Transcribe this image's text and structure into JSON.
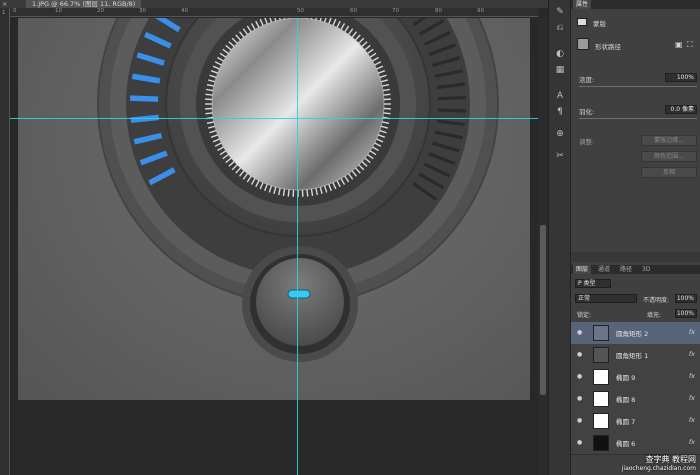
{
  "document": {
    "tab_label": "1.JPG @ 66.7% (图层 11, RGB/8)",
    "tab_close": "×"
  },
  "ruler": {
    "top_ticks": [
      "0",
      "10",
      "20",
      "30",
      "40",
      "50",
      "60",
      "70",
      "80",
      "90"
    ],
    "left_label": "1"
  },
  "tools": [
    "brush-icon",
    "history-icon",
    "adjust-icon",
    "swatch-icon",
    "type-icon",
    "paragraph-icon",
    "measure-icon",
    "tools-icon"
  ],
  "properties": {
    "header_tab": "属性",
    "mask_title": "蒙版",
    "mask_type": "形状路径",
    "density_label": "浓度:",
    "density_value": "100%",
    "feather_label": "羽化:",
    "feather_value": "0.0 像素",
    "refine_label": "调整:",
    "mask_edge_button": "蒙版边缘...",
    "color_range_button": "颜色范围...",
    "invert_button": "反相"
  },
  "layers_panel": {
    "tabs": [
      "图层",
      "通道",
      "路径",
      "3D"
    ],
    "kind_label": "P 类型",
    "blend_mode": "正常",
    "opacity_label": "不透明度:",
    "opacity_value": "100%",
    "lock_label": "锁定:",
    "fill_label": "填充:",
    "fill_value": "100%",
    "fx_label": "fx",
    "layers": [
      {
        "name": "圆角矩形 2",
        "selected": true
      },
      {
        "name": "圆角矩形 1",
        "selected": false
      },
      {
        "name": "椭圆 9",
        "selected": false
      },
      {
        "name": "椭圆 8",
        "selected": false
      },
      {
        "name": "椭圆 7",
        "selected": false
      },
      {
        "name": "椭圆 6",
        "selected": false
      }
    ]
  },
  "watermark": {
    "line1": "查字典 教程网",
    "line2": "jiaocheng.chazidian.com"
  },
  "colors": {
    "accent_blue": "#3a8fe8",
    "guide_cyan": "#27d4e6",
    "selected_layer": "#586479"
  },
  "knob": {
    "blue_segments": 12,
    "dark_segments": 22
  }
}
